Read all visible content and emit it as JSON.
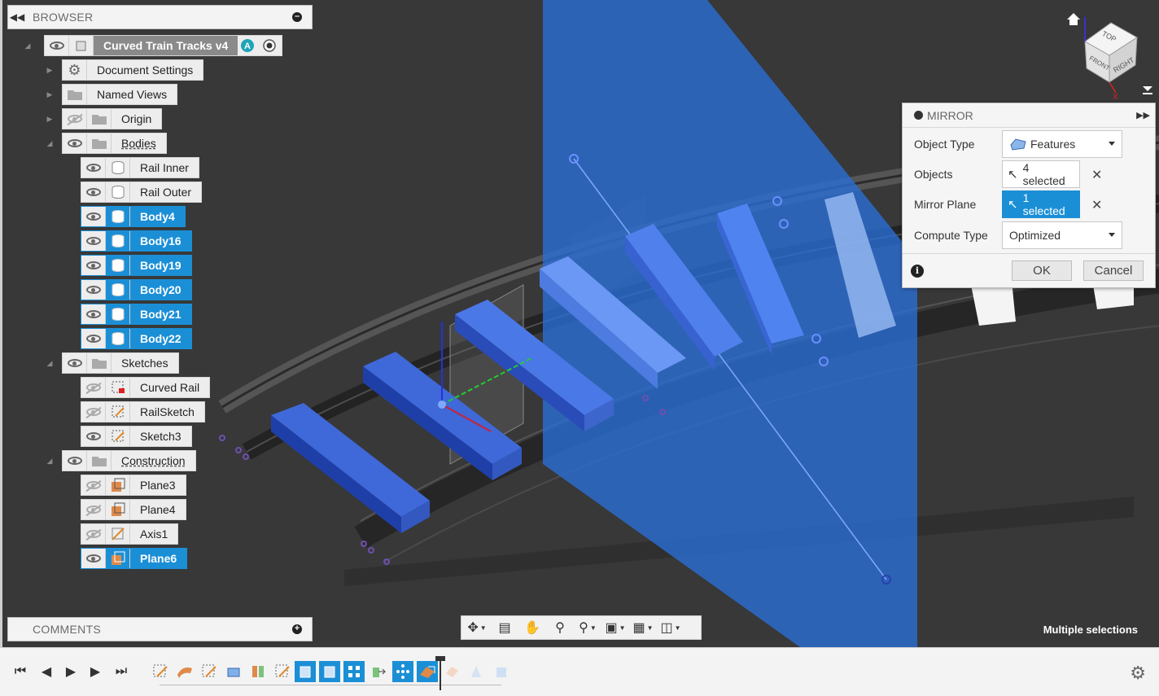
{
  "browser": {
    "title": "BROWSER",
    "root": {
      "label": "Curved Train Tracks v4"
    },
    "items": [
      {
        "label": "Document Settings"
      },
      {
        "label": "Named Views"
      },
      {
        "label": "Origin"
      },
      {
        "label": "Bodies"
      },
      {
        "label": "Rail Inner"
      },
      {
        "label": "Rail Outer"
      },
      {
        "label": "Body4"
      },
      {
        "label": "Body16"
      },
      {
        "label": "Body19"
      },
      {
        "label": "Body20"
      },
      {
        "label": "Body21"
      },
      {
        "label": "Body22"
      },
      {
        "label": "Sketches"
      },
      {
        "label": "Curved Rail"
      },
      {
        "label": "RailSketch"
      },
      {
        "label": "Sketch3"
      },
      {
        "label": "Construction"
      },
      {
        "label": "Plane3"
      },
      {
        "label": "Plane4"
      },
      {
        "label": "Axis1"
      },
      {
        "label": "Plane6"
      }
    ]
  },
  "comments": {
    "title": "COMMENTS"
  },
  "mirror": {
    "title": "MIRROR",
    "object_type_label": "Object Type",
    "object_type_value": "Features",
    "objects_label": "Objects",
    "objects_value": "4 selected",
    "mirror_plane_label": "Mirror Plane",
    "mirror_plane_value": "1 selected",
    "compute_type_label": "Compute Type",
    "compute_type_value": "Optimized",
    "ok_label": "OK",
    "cancel_label": "Cancel"
  },
  "viewcube": {
    "top": "TOP",
    "front": "FRONT",
    "right": "RIGHT"
  },
  "status": {
    "text": "Multiple selections"
  },
  "colors": {
    "selection_blue": "#1b8fd6",
    "plane_blue": "#2a6fd8",
    "viewport_bg": "#383838"
  }
}
